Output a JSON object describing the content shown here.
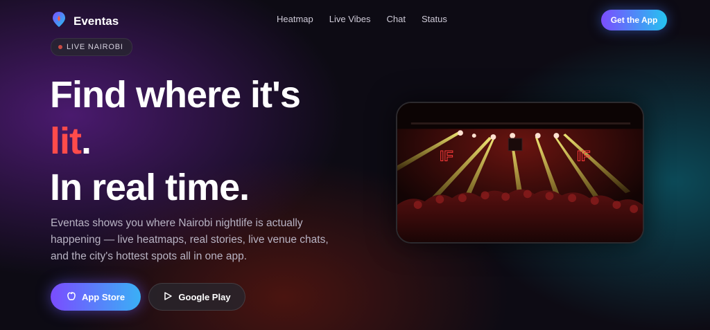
{
  "nav": {
    "brand": "Eventas",
    "links": [
      "Heatmap",
      "Live Vibes",
      "Chat",
      "Status"
    ],
    "cta_label": "Get the App"
  },
  "hero": {
    "badge": "LIVE NAIROBI",
    "headline_line1": "Find where it's",
    "headline_lit": "lit",
    "headline_period": ".",
    "headline_line3": "In real time.",
    "description": "Eventas shows you where Nairobi nightlife is actually happening — live heatmaps, real stories, live venue chats, and the city's hottest spots all in one app.",
    "app_store_label": "App Store",
    "google_play_label": "Google Play"
  },
  "colors": {
    "accent_gradient_start": "#7b4dff",
    "accent_gradient_end": "#25c3f0",
    "lit_red": "#ff4b4b"
  },
  "icons": {
    "logo": "location-pin-icon",
    "app_store": "apple-icon",
    "google_play": "play-icon"
  }
}
